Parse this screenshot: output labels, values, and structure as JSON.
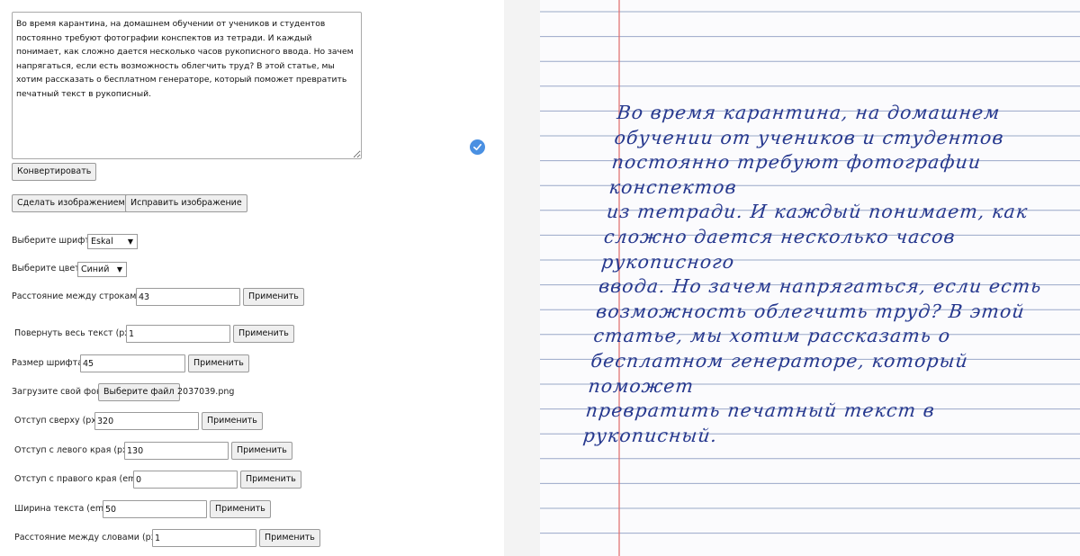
{
  "text_input": {
    "value": "Во время карантина, на домашнем обучении от учеников и студентов постоянно требуют фотографии конспектов из тетради. И каждый понимает, как сложно дается несколько часов рукописного ввода. Но зачем напрягаться, если есть возможность облегчить труд? В этой статье, мы хотим рассказать о бесплатном генераторе, который поможет превратить печатный текст в рукописный."
  },
  "buttons": {
    "convert": "Конвертировать",
    "make_image": "Сделать изображением",
    "fix_image": "Исправить изображение",
    "apply": "Применить",
    "choose_file": "Выберите файл"
  },
  "settings": {
    "font": {
      "label": "Выберите шрифт",
      "value": "Eskal"
    },
    "color": {
      "label": "Выберите цвет",
      "value": "Синий"
    },
    "line_spacing": {
      "label": "Расстояние между строками",
      "value": "43"
    },
    "rotate": {
      "label": "Повернуть весь текст (px)",
      "value": "1"
    },
    "font_size": {
      "label": "Размер шрифта",
      "value": "45"
    },
    "background": {
      "label": "Загрузите свой фон",
      "filename": "2037039.png"
    },
    "margin_top": {
      "label": "Отступ сверху (px)",
      "value": "320"
    },
    "margin_left": {
      "label": "Отступ с левого края (px)",
      "value": "130"
    },
    "margin_right": {
      "label": "Отступ с правого края (em)",
      "value": "0"
    },
    "text_width": {
      "label": "Ширина текста (em)",
      "value": "50"
    },
    "word_spacing": {
      "label": "Расстояние между словами (px)",
      "value": "1"
    }
  },
  "preview": {
    "handwriting_text": "Во время карантина, на домашнем\nобучении от учеников и студентов\nпостоянно требуют фотографии конспектов\nиз тетради. И каждый понимает, как\nсложно дается несколько часов рукописного\nввода. Но зачем напрягаться, если есть\nвозможность облегчить труд? В этой\nстатье, мы хотим рассказать о\nбесплатном генераторе, который поможет\nпревратить печатный текст в рукописный.",
    "ink_color": "#26388e",
    "rule_color": "#9aa8c8",
    "margin_color": "#e06a6a"
  },
  "colors": {
    "accent_badge": "#4a90e2"
  }
}
